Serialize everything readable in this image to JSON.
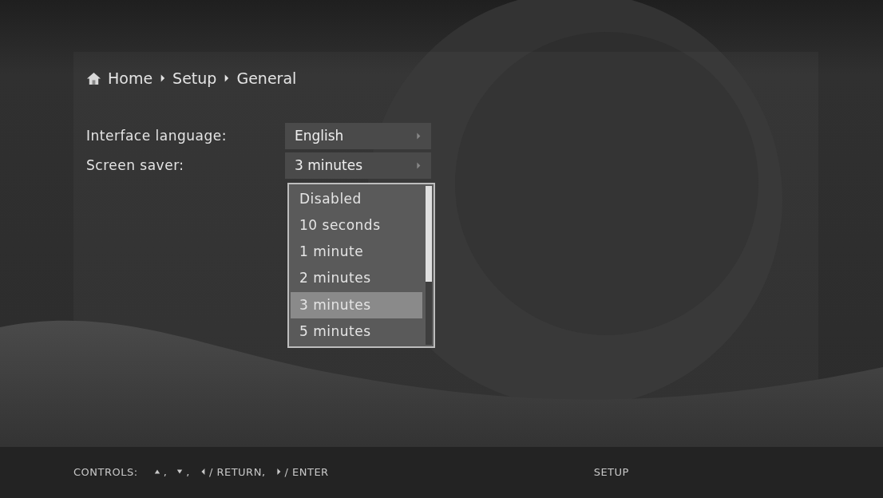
{
  "breadcrumb": [
    {
      "label": "Home"
    },
    {
      "label": "Setup"
    },
    {
      "label": "General"
    }
  ],
  "settings": [
    {
      "label": "Interface language:",
      "value": "English"
    },
    {
      "label": "Screen saver:",
      "value": "3 minutes"
    }
  ],
  "dropdown": {
    "options": [
      {
        "label": "Disabled",
        "selected": false
      },
      {
        "label": "10 seconds",
        "selected": false
      },
      {
        "label": "1 minute",
        "selected": false
      },
      {
        "label": "2 minutes",
        "selected": false
      },
      {
        "label": "3 minutes",
        "selected": true
      },
      {
        "label": "5 minutes",
        "selected": false
      }
    ]
  },
  "footer": {
    "label": "CONTROLS:",
    "controls": [
      {
        "kind": "up",
        "text": ","
      },
      {
        "kind": "down",
        "text": ","
      },
      {
        "kind": "left",
        "text": "/ RETURN,"
      },
      {
        "kind": "right",
        "text": "/ ENTER"
      }
    ],
    "section": "SETUP"
  }
}
